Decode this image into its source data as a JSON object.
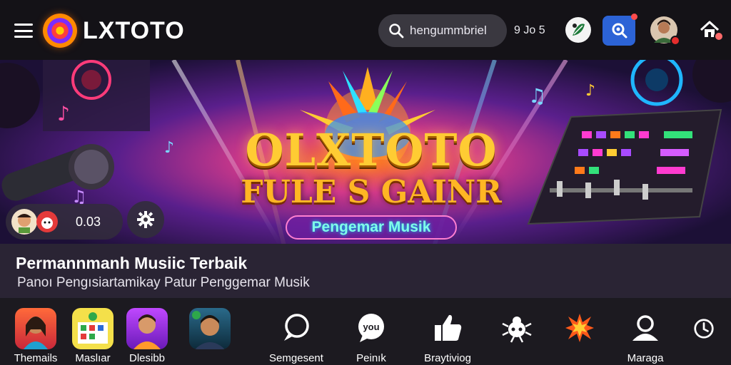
{
  "header": {
    "brand": "LXTOTO",
    "search_text": "hengummbriel",
    "counter": "9 Jo 5",
    "icons": [
      "menu-icon",
      "logo-icon",
      "search-icon",
      "leaf-avatar-icon",
      "notification-icon",
      "profile-avatar",
      "home-icon"
    ]
  },
  "hero": {
    "title": "OLXTOTO",
    "subtitle": "FULE S GAINR",
    "tag": "Pengemar Musik",
    "chip_value": "0.03"
  },
  "headline": {
    "title": "Permannmanh Musiic Terbaik",
    "subtitle": "Panoı Pengısiartamikay Patur Penggemar  Musik"
  },
  "bottom_nav": [
    {
      "label": "Themails",
      "icon": "woman-avatar-tile"
    },
    {
      "label": "Maslıar",
      "icon": "board-game-tile"
    },
    {
      "label": "Dlesibb",
      "icon": "man-avatar-tile"
    },
    {
      "label": "",
      "icon": "man-portrait-tile"
    },
    {
      "label": "Semgesent",
      "icon": "chat-bubble-icon"
    },
    {
      "label": "Peinık",
      "icon": "you-bubble-icon"
    },
    {
      "label": "Braytiviog",
      "icon": "thumbs-up-icon"
    },
    {
      "label": "",
      "icon": "bug-icon"
    },
    {
      "label": "",
      "icon": "explosion-icon"
    },
    {
      "label": "Maraga",
      "icon": "user-icon"
    },
    {
      "label": "",
      "icon": "clock-icon"
    }
  ],
  "colors": {
    "topbar": "#141217",
    "accent_blue": "#2c63d6",
    "title_gold": "#ffcc33",
    "headline_bg": "#2a2434",
    "nav_bg": "#1c1a20"
  }
}
